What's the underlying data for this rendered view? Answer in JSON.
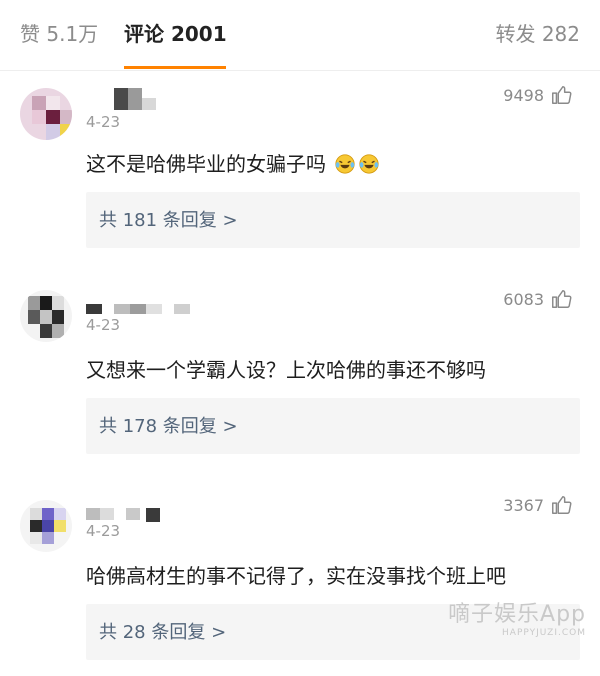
{
  "tabs": {
    "likes": "赞 5.1万",
    "comments": "评论 2001",
    "reposts": "转发 282",
    "active_color": "#ff8200"
  },
  "comments": [
    {
      "date": "4-23",
      "likes": "9498",
      "text": "这不是哈佛毕业的女骗子吗",
      "emoji": [
        "laughing-crying-emoji",
        "laughing-crying-emoji"
      ],
      "replies": "共 181 条回复 >"
    },
    {
      "date": "4-23",
      "likes": "6083",
      "text": "又想来一个学霸人设？上次哈佛的事还不够吗",
      "replies": "共 178 条回复 >"
    },
    {
      "date": "4-23",
      "likes": "3367",
      "text": "哈佛高材生的事不记得了，实在没事找个班上吧",
      "replies": "共 28 条回复 >"
    }
  ],
  "watermark": {
    "main": "嘀子娱乐App",
    "sub": "HAPPYJUZI.COM"
  },
  "icons": {
    "thumbs_up": "thumbs-up-icon"
  }
}
